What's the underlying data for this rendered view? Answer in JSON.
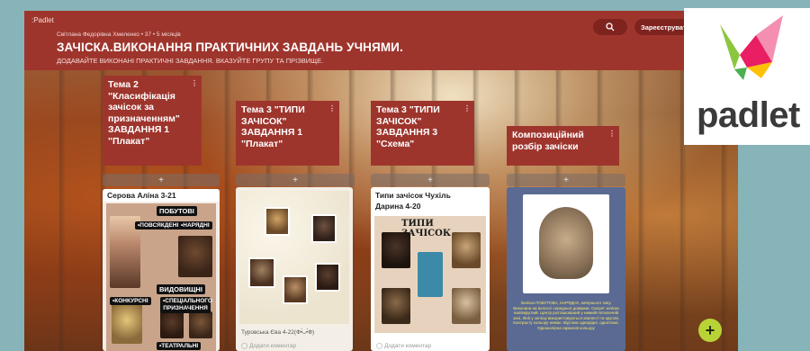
{
  "app": {
    "brand": ":Padlet",
    "author_line": "Світлана Федорівна Хмеленко • 37 • 5 місяців",
    "title": "ЗАЧІСКА.ВИКОНАННЯ ПРАКТИЧНИХ ЗАВДАНЬ УЧНЯМИ.",
    "description": "ДОДАВАЙТЕ ВИКОНАНІ ПРАКТИЧНІ ЗАВДАННЯ. ВКАЗУЙТЕ ГРУПУ ТА ПРІЗВИЩЕ.",
    "register_label": "Зареєструватися",
    "search_icon": "search-icon"
  },
  "columns": [
    {
      "title": "Тема 2 \"Класифікація зачісок за призначенням\" ЗАВДАННЯ 1 \"Плакат\"",
      "menu": "⋮",
      "add": "+",
      "card": {
        "title": "Серова Аліна 3-21",
        "labels": [
          "ПОБУТОВІ",
          "•ПОВСЯКДЕННІ",
          "•НАРЯДНІ",
          "ВИДОВИЩНІ",
          "•КОНКУРСНІ",
          "•СПЕЦІАЛЬНОГО ПРИЗНАЧЕННЯ",
          "•ТЕАТРАЛЬНІ"
        ]
      }
    },
    {
      "title": "Тема 3 \"ТИПИ ЗАЧІСОК\" ЗАВДАННЯ 1 \"Плакат\"",
      "menu": "⋮",
      "add": "+",
      "card": {
        "author": "Туровська Єва 4-22(Ф•̀ᴗ•́Ф)",
        "comment": "Додати коментар"
      }
    },
    {
      "title": "Тема 3 \"ТИПИ ЗАЧІСОК\" ЗАВДАННЯ 3 \"Схема\"",
      "menu": "⋮",
      "add": "+",
      "card": {
        "title": "Типи зачісок Чухіль Дарина 4-20",
        "poster_title": "ТИПИ ЗАЧІСОК",
        "comment": "Додати коментар"
      }
    },
    {
      "title": "Композиційний розбір зачіски",
      "menu": "⋮",
      "add": "+",
      "card": {
        "caption": "Зачіска ПОБУТОВА, НАРЯДНА, вечірнього типу. Виконана на волоссі середньої довжини. Силует зачіски напівкруглий. Центр розташований у нижній потиличній зоні. Лінії у зачісці використовуються хвилясті та кругові. Контрасту кольору немає. Відтінки однорідні, однотонні. Одноколірна гармонія кольору"
      }
    }
  ],
  "more_menu": "•••",
  "fab_label": "+",
  "logo": {
    "text": "padlet"
  },
  "colors": {
    "header": "#9e352d",
    "fab": "#b8d336",
    "page_bg": "#87b4b9"
  }
}
